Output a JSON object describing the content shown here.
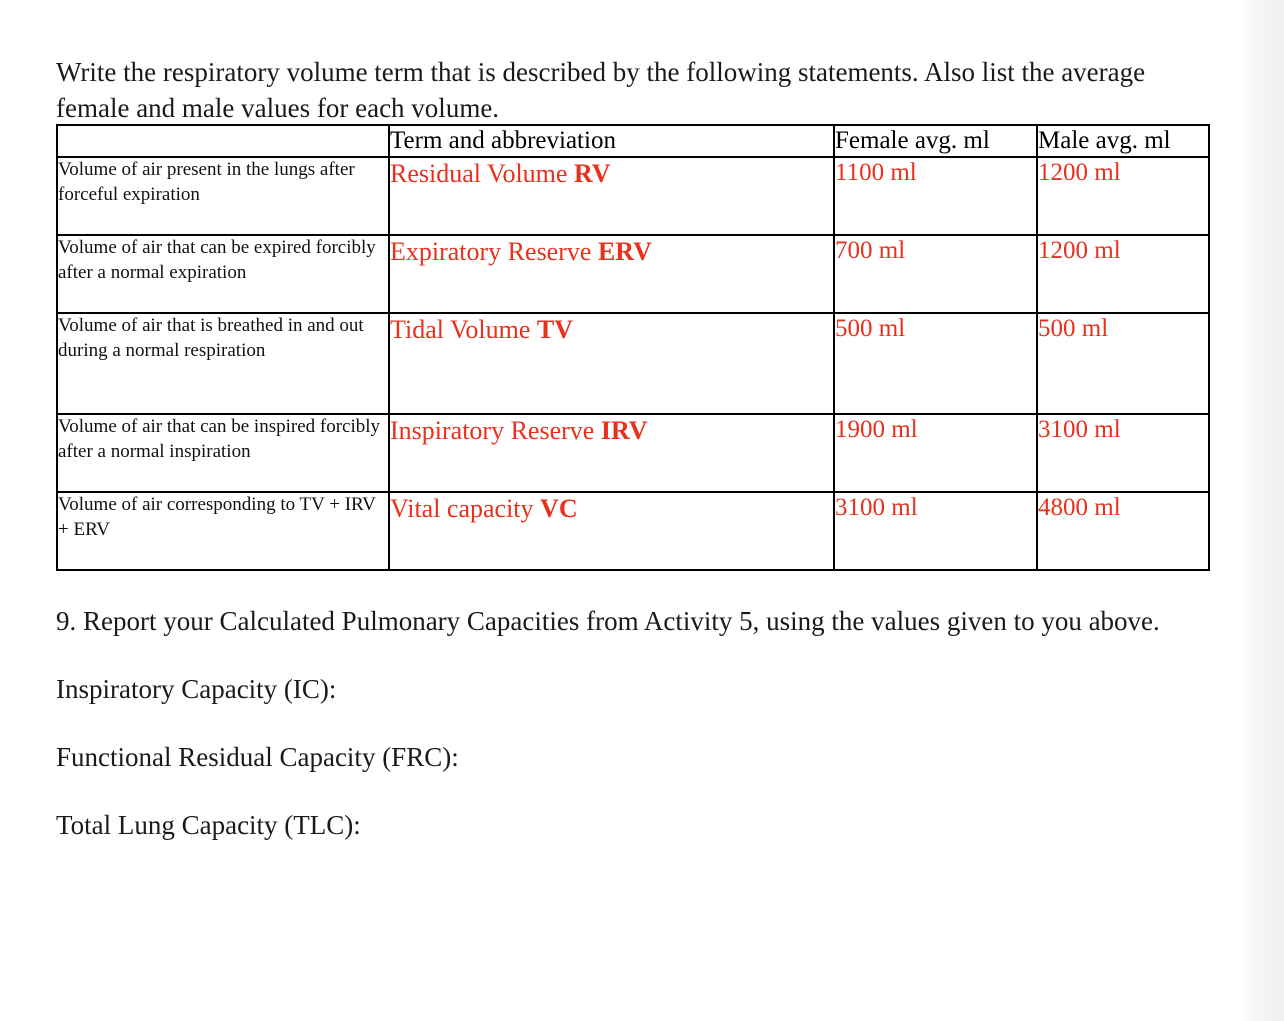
{
  "document": {
    "intro": "Write the respiratory volume term that is described by the following statements. Also list the average female and male values for each volume.",
    "answer_color": "#e8301c",
    "table": {
      "headers": {
        "description": "",
        "term": "Term and abbreviation",
        "female": "Female avg. ml",
        "male": "Male avg. ml"
      },
      "rows": [
        {
          "description": "Volume of air present in the lungs after forceful expiration",
          "term_name": "Residual Volume ",
          "term_abbr": "RV",
          "female": "1100 ml",
          "male": "1200 ml"
        },
        {
          "description": "Volume of air that can be expired forcibly after a normal expiration",
          "term_name": "Expiratory Reserve ",
          "term_abbr": "ERV",
          "female": "700 ml",
          "male": "1200 ml"
        },
        {
          "description": "Volume of air that is breathed in and out during a normal respiration",
          "term_name": "Tidal Volume ",
          "term_abbr": "TV",
          "female": "500 ml",
          "male": "500 ml"
        },
        {
          "description": "Volume of air that can be inspired forcibly after a normal inspiration",
          "term_name": "Inspiratory Reserve ",
          "term_abbr": "IRV",
          "female": "1900 ml",
          "male": "3100 ml"
        },
        {
          "description": "Volume of air corresponding to TV + IRV + ERV",
          "term_name": "Vital capacity ",
          "term_abbr": "VC",
          "female": "3100 ml",
          "male": "4800 ml"
        }
      ]
    },
    "question9": {
      "prompt": "9. Report your Calculated Pulmonary Capacities from Activity 5, using the values given to you above.",
      "items": [
        "Inspiratory Capacity (IC):",
        "Functional Residual Capacity (FRC):",
        "Total Lung Capacity (TLC):"
      ]
    }
  }
}
